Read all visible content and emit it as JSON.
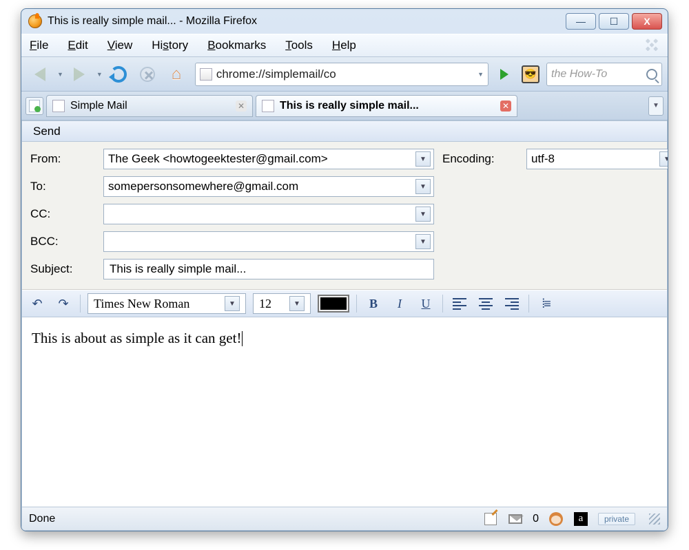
{
  "window": {
    "title": "This is really simple mail... - Mozilla Firefox"
  },
  "menus": {
    "file": "File",
    "edit": "Edit",
    "view": "View",
    "history": "History",
    "bookmarks": "Bookmarks",
    "tools": "Tools",
    "help": "Help"
  },
  "navbar": {
    "url": "chrome://simplemail/co",
    "search_placeholder": "the How-To"
  },
  "tabs": {
    "tab1": "Simple Mail",
    "tab2": "This is really simple mail..."
  },
  "compose": {
    "send_label": "Send",
    "labels": {
      "from": "From:",
      "to": "To:",
      "cc": "CC:",
      "bcc": "BCC:",
      "subject": "Subject:",
      "encoding": "Encoding:"
    },
    "from": "The Geek <howtogeektester@gmail.com>",
    "to": "somepersonsomewhere@gmail.com",
    "cc": "",
    "bcc": "",
    "subject": "This is really simple mail...",
    "encoding": "utf-8"
  },
  "editor": {
    "font": "Times New Roman",
    "size": "12",
    "body": "This is about as simple as it can get!"
  },
  "status": {
    "left": "Done",
    "mail_count": "0",
    "private": "private"
  }
}
